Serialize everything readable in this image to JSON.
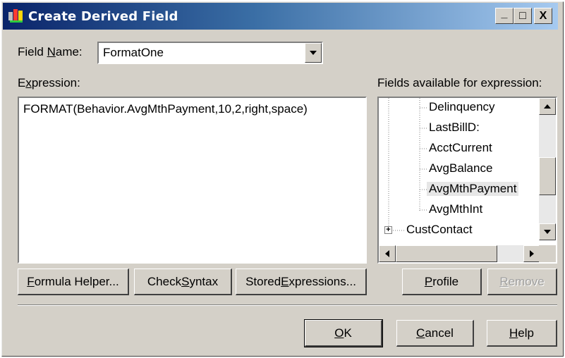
{
  "window": {
    "title": "Create Derived Field",
    "controls": {
      "minimize": "_",
      "maximize": "□",
      "close": "X"
    }
  },
  "field_name": {
    "label_prefix": "Field ",
    "label_accel": "N",
    "label_suffix": "ame:",
    "value": "FormatOne"
  },
  "expression": {
    "label_prefix": "E",
    "label_accel": "x",
    "label_suffix": "pression:",
    "value": "FORMAT(Behavior.AvgMthPayment,10,2,right,space)"
  },
  "fields_panel": {
    "label": "Fields available for expression:",
    "items": [
      {
        "label": "Delinquency",
        "selected": false
      },
      {
        "label": "LastBillD:",
        "selected": false
      },
      {
        "label": "AcctCurrent",
        "selected": false
      },
      {
        "label": "AvgBalance",
        "selected": false
      },
      {
        "label": "AvgMthPayment",
        "selected": true
      },
      {
        "label": "AvgMthInt",
        "selected": false
      }
    ],
    "group_item": {
      "label": "CustContact",
      "expander": "+"
    }
  },
  "buttons": {
    "formula_helper": {
      "prefix": "",
      "accel": "F",
      "suffix": "ormula Helper..."
    },
    "check_syntax": {
      "prefix": "Check ",
      "accel": "S",
      "suffix": "yntax"
    },
    "stored_expressions": {
      "prefix": "Stored ",
      "accel": "E",
      "suffix": "xpressions..."
    },
    "profile": {
      "prefix": "",
      "accel": "P",
      "suffix": "rofile"
    },
    "remove": {
      "prefix": "",
      "accel": "R",
      "suffix": "emove",
      "enabled": false
    },
    "ok": {
      "prefix": "",
      "accel": "O",
      "suffix": "K"
    },
    "cancel": {
      "prefix": "",
      "accel": "C",
      "suffix": "ancel"
    },
    "help": {
      "prefix": "",
      "accel": "H",
      "suffix": "elp"
    }
  },
  "colors": {
    "dialog_bg": "#d4d0c8",
    "title_gradient_start": "#0a246a",
    "title_gradient_end": "#a6caf0",
    "disabled_text": "#a0a0a0"
  }
}
